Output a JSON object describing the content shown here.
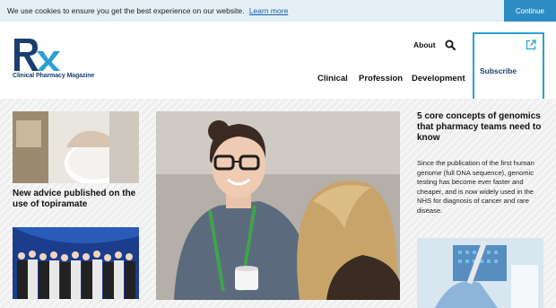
{
  "cookie_banner": {
    "message": "We use cookies to ensure you get the best experience on our website.",
    "learn_more": "Learn more",
    "continue_label": "Continue"
  },
  "header": {
    "logo_text": "Rx",
    "tagline": "Clinical Pharmacy Magazine",
    "about_label": "About",
    "search_icon": "search-icon",
    "nav": [
      "Clinical",
      "Profession",
      "Development"
    ],
    "subscribe_label": "Subscribe",
    "subscribe_icon": "external-link-icon"
  },
  "articles": {
    "topiramate": {
      "headline": "New advice published on the use of topiramate"
    },
    "genomics": {
      "headline": "5 core concepts of genomics that pharmacy teams need to know",
      "summary": "Since the publication of the first human genome (full DNA sequence), genomic testing has become ever faster and cheaper, and is now widely used in the NHS for diagnosis of cancer and rare disease."
    },
    "group": {
      "headline": ""
    }
  },
  "colors": {
    "brand_navy": "#1a3e70",
    "brand_blue": "#2aa0d4",
    "cookie_bg": "#e4f0f6",
    "cookie_button": "#2e8cc4"
  }
}
